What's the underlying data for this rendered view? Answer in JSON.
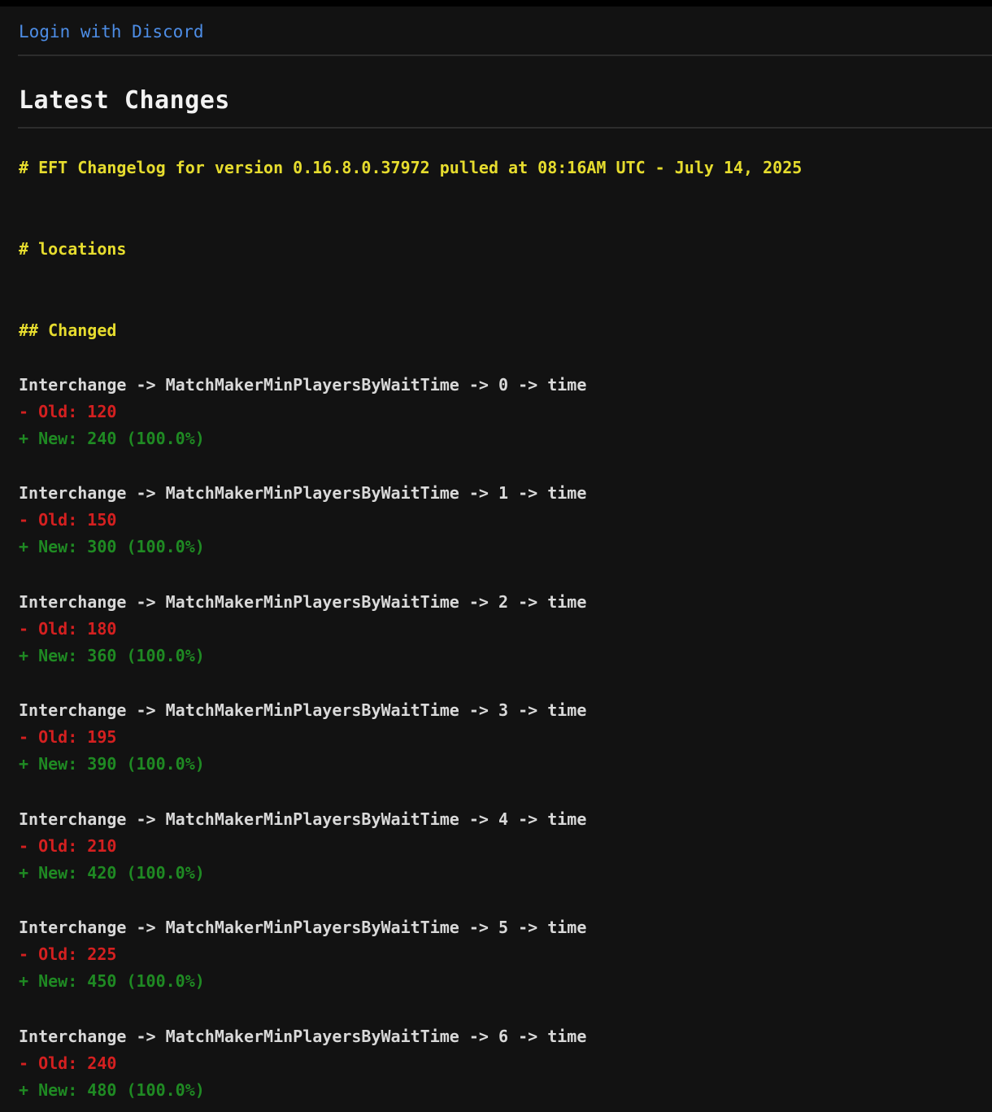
{
  "header": {
    "login_label": "Login with Discord"
  },
  "main": {
    "title": "Latest Changes",
    "changelog_heading": "# EFT Changelog for version 0.16.8.0.37972 pulled at 08:16AM UTC - July 14, 2025",
    "section_heading": "# locations",
    "subsection_heading": "## Changed",
    "entries": [
      {
        "path": "Interchange -> MatchMakerMinPlayersByWaitTime -> 0 -> time",
        "old": "- Old: 120",
        "new": "+ New: 240 (100.0%)"
      },
      {
        "path": "Interchange -> MatchMakerMinPlayersByWaitTime -> 1 -> time",
        "old": "- Old: 150",
        "new": "+ New: 300 (100.0%)"
      },
      {
        "path": "Interchange -> MatchMakerMinPlayersByWaitTime -> 2 -> time",
        "old": "- Old: 180",
        "new": "+ New: 360 (100.0%)"
      },
      {
        "path": "Interchange -> MatchMakerMinPlayersByWaitTime -> 3 -> time",
        "old": "- Old: 195",
        "new": "+ New: 390 (100.0%)"
      },
      {
        "path": "Interchange -> MatchMakerMinPlayersByWaitTime -> 4 -> time",
        "old": "- Old: 210",
        "new": "+ New: 420 (100.0%)"
      },
      {
        "path": "Interchange -> MatchMakerMinPlayersByWaitTime -> 5 -> time",
        "old": "- Old: 225",
        "new": "+ New: 450 (100.0%)"
      },
      {
        "path": "Interchange -> MatchMakerMinPlayersByWaitTime -> 6 -> time",
        "old": "- Old: 240",
        "new": "+ New: 480 (100.0%)"
      }
    ]
  },
  "colors": {
    "background": "#121212",
    "link": "#4d8de6",
    "heading": "#e6dc2e",
    "old_value": "#d42020",
    "new_value": "#1f8a23"
  }
}
